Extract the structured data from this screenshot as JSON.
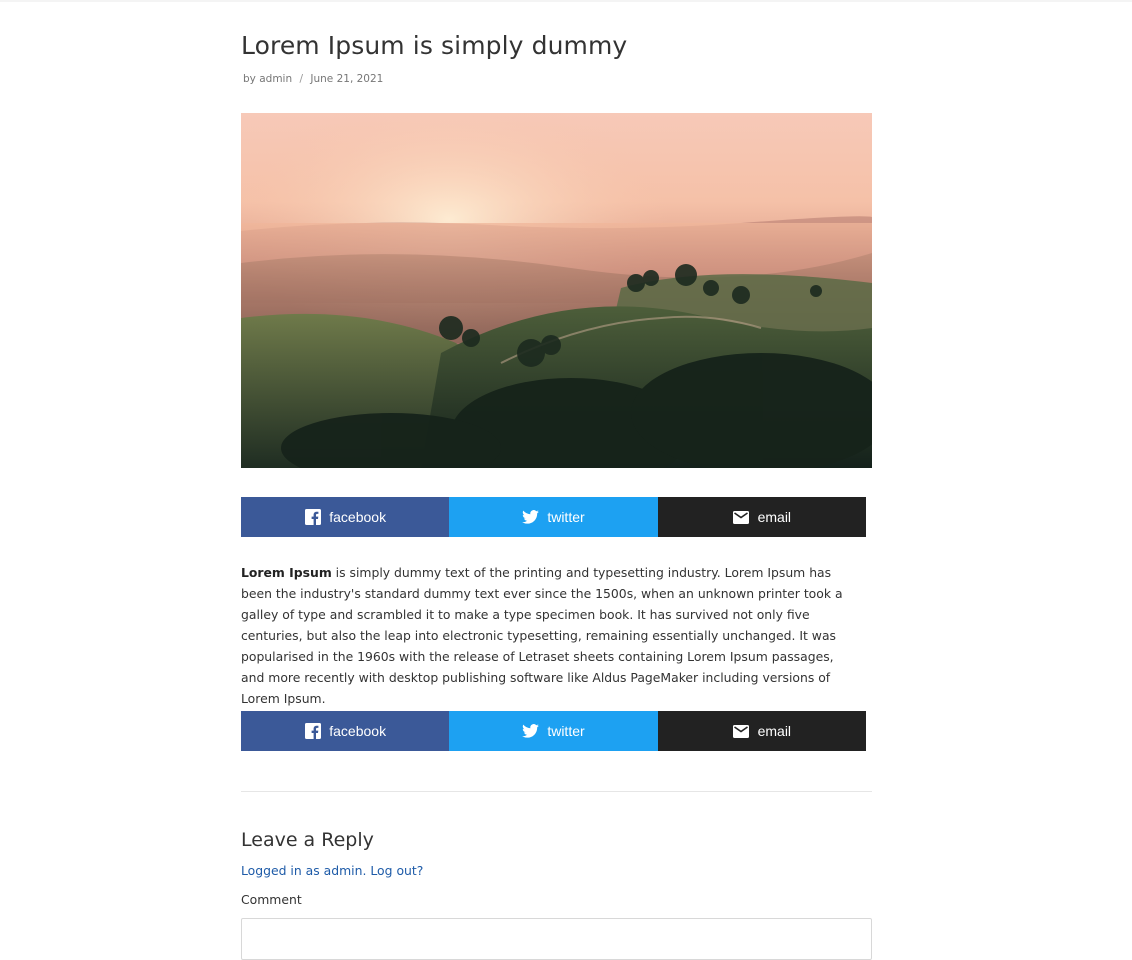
{
  "post": {
    "title": "Lorem Ipsum is simply dummy",
    "meta": {
      "by_label": "by",
      "author": "admin",
      "separator": "/",
      "date": "June 21, 2021"
    },
    "hero_image": {
      "alt": "Foggy sunrise over rolling green hills"
    },
    "body": {
      "lead": "Lorem Ipsum",
      "rest": " is simply dummy text of the printing and typesetting industry. Lorem Ipsum has been the industry's standard dummy text ever since the 1500s, when an unknown printer took a galley of type and scrambled it to make a type specimen book. It has survived not only five centuries, but also the leap into electronic typesetting, remaining essentially unchanged. It was popularised in the 1960s with the release of Letraset sheets containing Lorem Ipsum passages, and more recently with desktop publishing software like Aldus PageMaker including versions of Lorem Ipsum."
    }
  },
  "share": {
    "facebook": {
      "label": "facebook",
      "icon": "facebook-icon",
      "color": "#3b5998"
    },
    "twitter": {
      "label": "twitter",
      "icon": "twitter-icon",
      "color": "#1da1f2"
    },
    "email": {
      "label": "email",
      "icon": "email-icon",
      "color": "#222222"
    }
  },
  "comments": {
    "title": "Leave a Reply",
    "logged_in_text": "Logged in as admin.",
    "logout_text": "Log out?",
    "comment_label": "Comment",
    "comment_value": ""
  },
  "colors": {
    "link": "#1e5ba8",
    "text": "#333333"
  }
}
